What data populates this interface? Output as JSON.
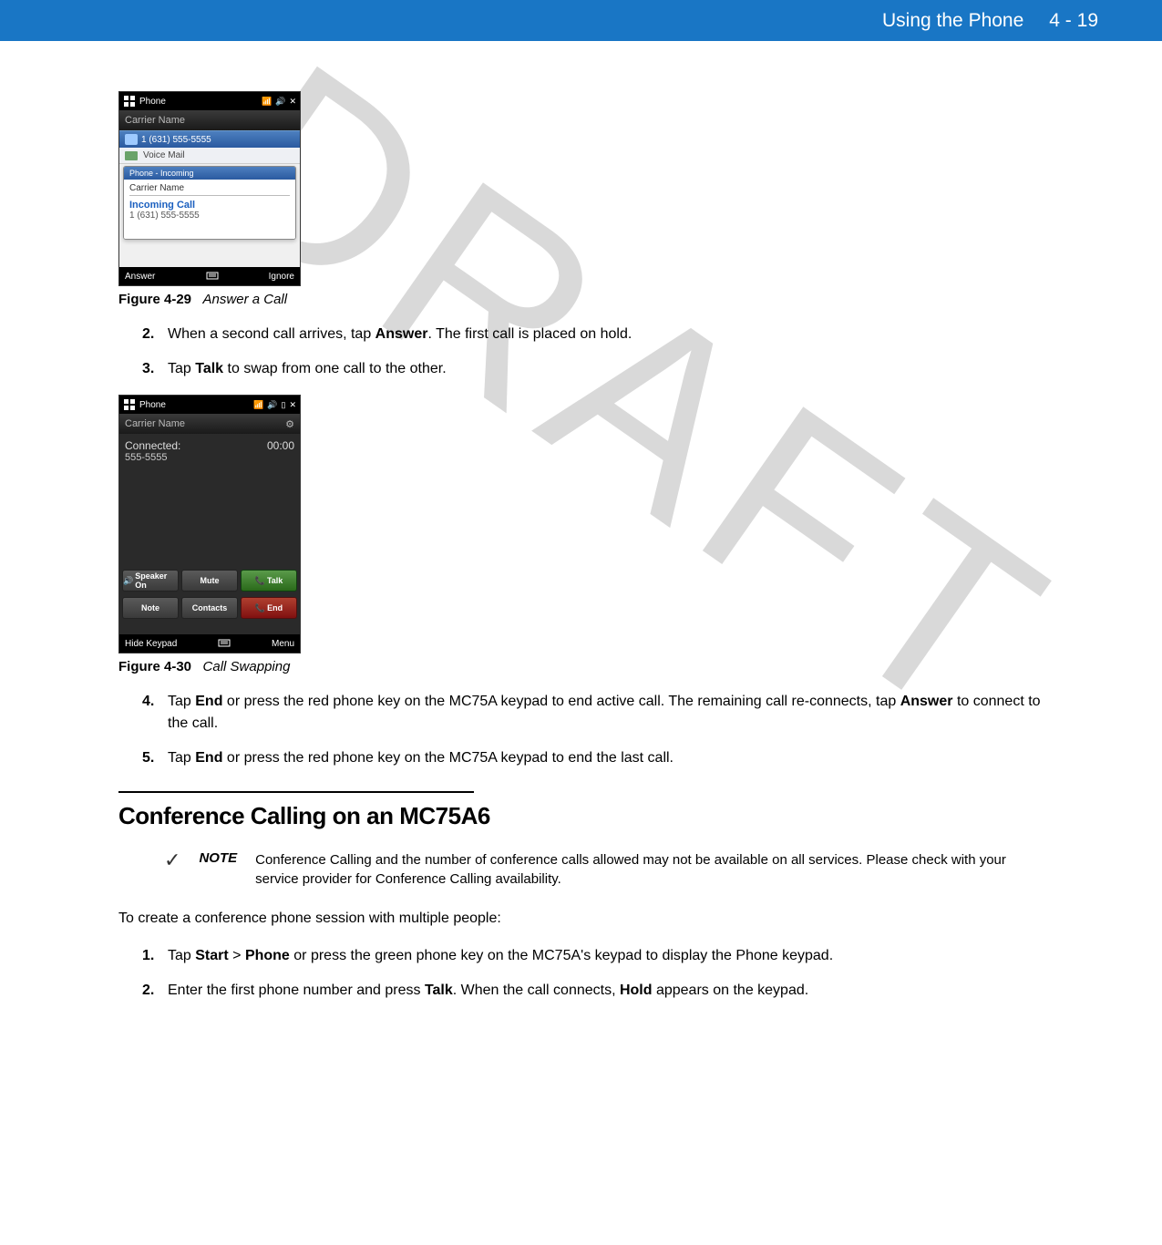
{
  "header": {
    "chapter_title": "Using the Phone",
    "page_number": "4 - 19"
  },
  "watermark": "DRAFT",
  "screenshot1": {
    "title": "Phone",
    "carrier": "Carrier Name",
    "row1": "1 (631) 555-5555",
    "row2": "Voice Mail",
    "popup_title": "Phone - Incoming",
    "popup_carrier": "Carrier Name",
    "popup_line1": "Incoming Call",
    "popup_line2": "1 (631) 555-5555",
    "sk_left": "Answer",
    "sk_right": "Ignore"
  },
  "fig29": {
    "label": "Figure 4-29",
    "title": "Answer a Call"
  },
  "steps_a": [
    {
      "n": "2.",
      "html": "When a second call arrives, tap <b>Answer</b>. The first call is placed on hold."
    },
    {
      "n": "3.",
      "html": "Tap <b>Talk</b> to swap from one call to the other."
    }
  ],
  "screenshot2": {
    "title": "Phone",
    "carrier": "Carrier Name",
    "status": "Connected:",
    "timer": "00:00",
    "number": "555-5555",
    "btn_speaker": "Speaker On",
    "btn_mute": "Mute",
    "btn_talk": "Talk",
    "btn_note": "Note",
    "btn_contacts": "Contacts",
    "btn_end": "End",
    "sk_left": "Hide Keypad",
    "sk_right": "Menu"
  },
  "fig30": {
    "label": "Figure 4-30",
    "title": "Call Swapping"
  },
  "steps_b": [
    {
      "n": "4.",
      "html": "Tap <b>End</b> or press the red phone key on the MC75A keypad to end active call. The remaining call re-connects, tap <b>Answer</b> to connect to the call."
    },
    {
      "n": "5.",
      "html": "Tap <b>End</b> or press the red phone key on the MC75A keypad to end the last call."
    }
  ],
  "section_heading": "Conference Calling on an MC75A6",
  "note": {
    "label": "NOTE",
    "text": "Conference Calling and the number of conference calls allowed may not be available on all services. Please check with your service provider for Conference Calling availability."
  },
  "body_para": "To create a conference phone session with multiple people:",
  "steps_c": [
    {
      "n": "1.",
      "html": "Tap <b>Start</b> > <b>Phone</b> or press the green phone key on the MC75A's keypad to display the Phone keypad."
    },
    {
      "n": "2.",
      "html": "Enter the first phone number and press <b>Talk</b>. When the call connects, <b>Hold</b> appears on the keypad."
    }
  ]
}
